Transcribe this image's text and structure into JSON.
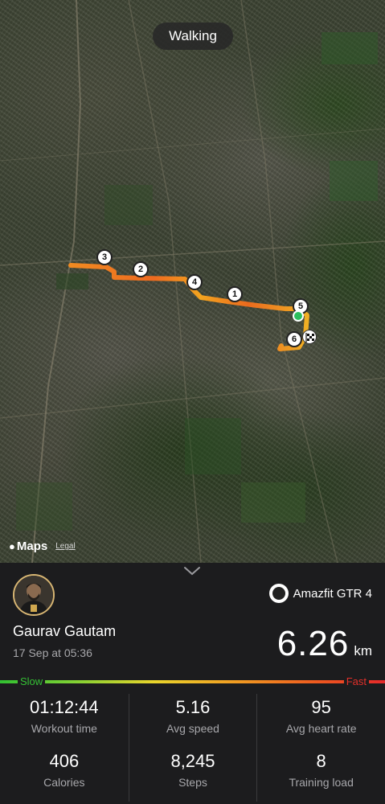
{
  "map": {
    "activity_label": "Walking",
    "attribution_brand": "Maps",
    "legal_link": "Legal",
    "route_markers": [
      {
        "label": "3"
      },
      {
        "label": "2"
      },
      {
        "label": "4"
      },
      {
        "label": "1"
      },
      {
        "label": "5"
      },
      {
        "label": "6"
      }
    ],
    "start_icon": "start-pin-icon",
    "finish_icon": "checkered-flag-icon"
  },
  "summary": {
    "user_name": "Gaurav Gautam",
    "date": "17 Sep at 05:36",
    "device_name": "Amazfit GTR 4",
    "device_icon": "watch-icon",
    "distance_value": "6.26",
    "distance_unit": "km",
    "speed_legend": {
      "slow": "Slow",
      "fast": "Fast"
    }
  },
  "stats": [
    {
      "value": "01:12:44",
      "label": "Workout time"
    },
    {
      "value": "5.16",
      "label": "Avg speed"
    },
    {
      "value": "95",
      "label": "Avg heart rate"
    },
    {
      "value": "406",
      "label": "Calories"
    },
    {
      "value": "8,245",
      "label": "Steps"
    },
    {
      "value": "8",
      "label": "Training load"
    }
  ],
  "colors": {
    "slow": "#32c032",
    "medium": "#e9d52c",
    "fast": "#e5292a",
    "avatar_ring": "#d8b673",
    "start_pin": "#2bbf5d"
  }
}
